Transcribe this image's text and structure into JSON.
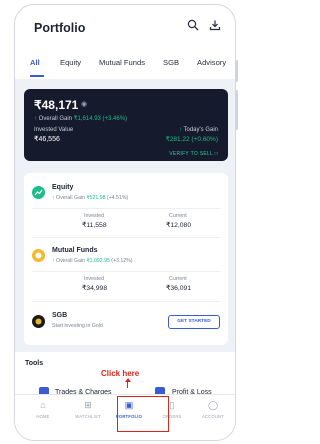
{
  "header": {
    "title": "Portfolio",
    "search_icon": "search-icon",
    "download_icon": "download-icon"
  },
  "tabs": [
    {
      "label": "All",
      "active": true
    },
    {
      "label": "Equity",
      "active": false
    },
    {
      "label": "Mutual Funds",
      "active": false
    },
    {
      "label": "SGB",
      "active": false
    },
    {
      "label": "Advisory",
      "active": false
    }
  ],
  "summary": {
    "total_value": "₹48,171",
    "overall_gain_label": "Overall Gain",
    "overall_gain_value": "₹1,614.93 (+3.46%)",
    "invested_label": "Invested Value",
    "invested_value": "₹46,556",
    "today_gain_label": "Today's Gain",
    "today_gain_value": "₹281.22 (+0.60%)",
    "verify_label": "VERIFY TO SELL"
  },
  "holdings": {
    "equity": {
      "name": "Equity",
      "gain_label": "Overall Gain",
      "gain_value": "₹521.98",
      "gain_pct": "(+4.51%)",
      "invested_label": "Invested",
      "invested_value": "₹11,558",
      "current_label": "Current",
      "current_value": "₹12,080"
    },
    "mutual_funds": {
      "name": "Mutual Funds",
      "gain_label": "Overall Gain",
      "gain_value": "₹1,092.95",
      "gain_pct": "(+3.12%)",
      "invested_label": "Invested",
      "invested_value": "₹34,998",
      "current_label": "Current",
      "current_value": "₹36,091"
    },
    "sgb": {
      "name": "SGB",
      "subtitle": "Start investing in Gold",
      "button_label": "GET STARTED"
    }
  },
  "tools": {
    "title": "Tools",
    "items": [
      "Trades & Charges",
      "Profit & Loss"
    ]
  },
  "annotation": {
    "text": "Click here",
    "color": "#e0241b"
  },
  "bottom_nav": [
    {
      "label": "HOME",
      "icon": "home-icon",
      "active": false
    },
    {
      "label": "WATCHLIST",
      "icon": "watchlist-icon",
      "active": false
    },
    {
      "label": "PORTFOLIO",
      "icon": "portfolio-icon",
      "active": true
    },
    {
      "label": "ORDERS",
      "icon": "orders-icon",
      "active": false
    },
    {
      "label": "ACCOUNT",
      "icon": "account-icon",
      "active": false
    }
  ],
  "colors": {
    "accent": "#3b5cd1",
    "gain_green": "#1bbd8b",
    "summary_bg": "#151b2c"
  }
}
